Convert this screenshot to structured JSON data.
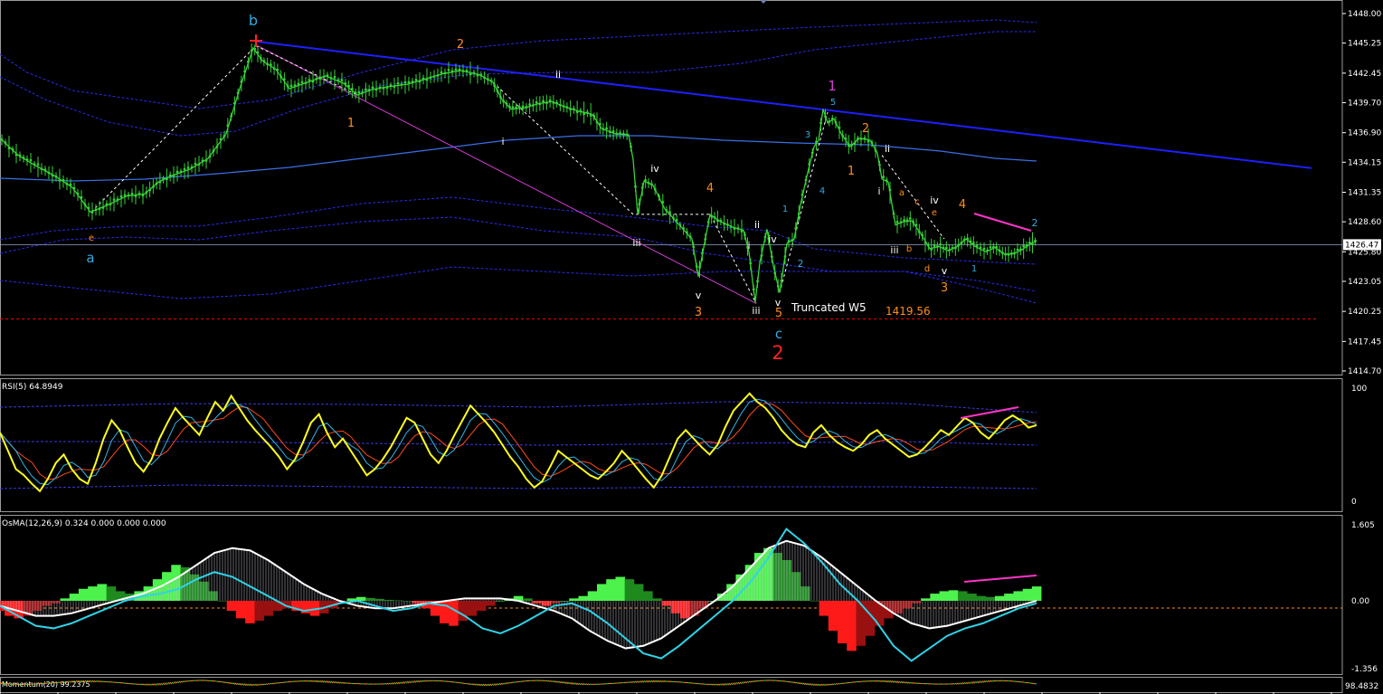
{
  "chart_data": {
    "type": "line",
    "main": {
      "y_ticks": [
        "1448.00",
        "1445.25",
        "1442.45",
        "1439.70",
        "1436.90",
        "1434.15",
        "1431.35",
        "1428.60",
        "1425.80",
        "1423.05",
        "1420.25",
        "1417.45",
        "1414.70"
      ],
      "ylim": [
        1414.7,
        1448.0
      ],
      "current_price": "1426.47",
      "reference_level": 1419.56,
      "reference_level_label": "1419.56",
      "annotation": "Truncated W5",
      "colors": {
        "bull": "#37d337",
        "bear": "#37d337",
        "trendline": "#1f1fff",
        "envelope": "#2a2ae8",
        "ma": "#3b6fe6",
        "support": "#ff0000",
        "divergence": "#ff35c9",
        "wave_orange": "#ff8c1a",
        "wave_cyan": "#36a9e1",
        "wave_purple": "#d43bd4",
        "wave_red": "#ff2222"
      },
      "price_path": [
        [
          0,
          1436.4
        ],
        [
          20,
          1434.8
        ],
        [
          40,
          1433.8
        ],
        [
          60,
          1432.9
        ],
        [
          80,
          1431.8
        ],
        [
          100,
          1429.5
        ],
        [
          120,
          1430.2
        ],
        [
          140,
          1431.0
        ],
        [
          160,
          1431.2
        ],
        [
          175,
          1432.3
        ],
        [
          190,
          1432.9
        ],
        [
          210,
          1433.5
        ],
        [
          230,
          1434.5
        ],
        [
          250,
          1436.8
        ],
        [
          265,
          1441.0
        ],
        [
          280,
          1444.8
        ],
        [
          290,
          1443.6
        ],
        [
          305,
          1442.8
        ],
        [
          320,
          1441.0
        ],
        [
          340,
          1441.6
        ],
        [
          360,
          1442.2
        ],
        [
          380,
          1441.5
        ],
        [
          395,
          1440.4
        ],
        [
          410,
          1440.9
        ],
        [
          430,
          1441.2
        ],
        [
          450,
          1441.4
        ],
        [
          470,
          1441.9
        ],
        [
          490,
          1442.4
        ],
        [
          510,
          1442.7
        ],
        [
          530,
          1442.3
        ],
        [
          545,
          1441.6
        ],
        [
          555,
          1440.0
        ],
        [
          565,
          1439.1
        ],
        [
          580,
          1439.2
        ],
        [
          595,
          1439.6
        ],
        [
          610,
          1439.8
        ],
        [
          625,
          1439.3
        ],
        [
          640,
          1438.9
        ],
        [
          655,
          1438.6
        ],
        [
          665,
          1437.3
        ],
        [
          680,
          1436.8
        ],
        [
          695,
          1436.7
        ],
        [
          700,
          1434.4
        ],
        [
          705,
          1429.3
        ],
        [
          712,
          1432.4
        ],
        [
          722,
          1432.0
        ],
        [
          735,
          1429.8
        ],
        [
          750,
          1428.4
        ],
        [
          765,
          1427.0
        ],
        [
          772,
          1423.5
        ],
        [
          778,
          1426.2
        ],
        [
          785,
          1429.3
        ],
        [
          795,
          1428.7
        ],
        [
          810,
          1428.1
        ],
        [
          822,
          1427.8
        ],
        [
          828,
          1425.8
        ],
        [
          835,
          1421.1
        ],
        [
          840,
          1424.8
        ],
        [
          848,
          1427.9
        ],
        [
          855,
          1424.5
        ],
        [
          862,
          1422.0
        ],
        [
          870,
          1426.6
        ],
        [
          878,
          1427.0
        ],
        [
          885,
          1430.2
        ],
        [
          893,
          1433.2
        ],
        [
          900,
          1435.6
        ],
        [
          905,
          1436.2
        ],
        [
          910,
          1439.1
        ],
        [
          915,
          1437.8
        ],
        [
          922,
          1438.2
        ],
        [
          930,
          1436.8
        ],
        [
          940,
          1435.6
        ],
        [
          950,
          1436.4
        ],
        [
          962,
          1436.2
        ],
        [
          970,
          1435.0
        ],
        [
          975,
          1432.6
        ],
        [
          982,
          1432.3
        ],
        [
          990,
          1428.3
        ],
        [
          998,
          1428.6
        ],
        [
          1008,
          1428.7
        ],
        [
          1018,
          1427.5
        ],
        [
          1028,
          1426.1
        ],
        [
          1038,
          1426.3
        ],
        [
          1048,
          1425.9
        ],
        [
          1058,
          1426.3
        ],
        [
          1068,
          1427.0
        ],
        [
          1078,
          1426.3
        ],
        [
          1090,
          1425.8
        ],
        [
          1100,
          1426.2
        ],
        [
          1110,
          1425.6
        ],
        [
          1120,
          1425.6
        ],
        [
          1130,
          1426.0
        ],
        [
          1140,
          1426.6
        ],
        [
          1146,
          1426.8
        ]
      ],
      "wave_labels": [
        {
          "text": "b",
          "x": 280,
          "y": 28,
          "color": "#36a9e1",
          "size": 16
        },
        {
          "text": "a",
          "x": 100,
          "y": 290,
          "color": "#36a9e1",
          "size": 15
        },
        {
          "text": "e",
          "x": 101,
          "y": 266,
          "color": "#ff8c1a",
          "size": 10
        },
        {
          "text": "2",
          "x": 509,
          "y": 53,
          "color": "#ff8c1a",
          "size": 13
        },
        {
          "text": "1",
          "x": 388,
          "y": 140,
          "color": "#ff8c1a",
          "size": 13
        },
        {
          "text": "ii",
          "x": 617,
          "y": 86,
          "color": "#ffffff",
          "size": 11
        },
        {
          "text": "i",
          "x": 556,
          "y": 160,
          "color": "#ffffff",
          "size": 11
        },
        {
          "text": "iv",
          "x": 724,
          "y": 190,
          "color": "#ffffff",
          "size": 11
        },
        {
          "text": "iii",
          "x": 704,
          "y": 272,
          "color": "#ffffff",
          "size": 11
        },
        {
          "text": "4",
          "x": 785,
          "y": 212,
          "color": "#ff8c1a",
          "size": 13
        },
        {
          "text": "v",
          "x": 772,
          "y": 330,
          "color": "#ffffff",
          "size": 11
        },
        {
          "text": "3",
          "x": 772,
          "y": 349,
          "color": "#ff8c1a",
          "size": 13
        },
        {
          "text": "ii",
          "x": 837,
          "y": 252,
          "color": "#ffffff",
          "size": 11
        },
        {
          "text": "i",
          "x": 828,
          "y": 275,
          "color": "#ffffff",
          "size": 11
        },
        {
          "text": "iv",
          "x": 854,
          "y": 268,
          "color": "#ffffff",
          "size": 11
        },
        {
          "text": "iii",
          "x": 836,
          "y": 347,
          "color": "#ffffff",
          "size": 11
        },
        {
          "text": "v",
          "x": 860,
          "y": 338,
          "color": "#ffffff",
          "size": 11
        },
        {
          "text": "5",
          "x": 861,
          "y": 350,
          "color": "#ff8c1a",
          "size": 13
        },
        {
          "text": "c",
          "x": 861,
          "y": 374,
          "color": "#36a9e1",
          "size": 15
        },
        {
          "text": "2",
          "x": 860,
          "y": 397,
          "color": "#ff2222",
          "size": 21
        },
        {
          "text": "1",
          "x": 920,
          "y": 100,
          "color": "#d43bd4",
          "size": 15
        },
        {
          "text": "5",
          "x": 921,
          "y": 116,
          "color": "#36a9e1",
          "size": 10
        },
        {
          "text": "3",
          "x": 893,
          "y": 152,
          "color": "#36a9e1",
          "size": 10
        },
        {
          "text": "4",
          "x": 909,
          "y": 214,
          "color": "#36a9e1",
          "size": 10
        },
        {
          "text": "1",
          "x": 868,
          "y": 234,
          "color": "#36a9e1",
          "size": 10
        },
        {
          "text": "2",
          "x": 885,
          "y": 295,
          "color": "#36a9e1",
          "size": 11
        },
        {
          "text": "2",
          "x": 957,
          "y": 146,
          "color": "#ff8c1a",
          "size": 13
        },
        {
          "text": "1",
          "x": 941,
          "y": 193,
          "color": "#ff8c1a",
          "size": 13
        },
        {
          "text": "ii",
          "x": 981,
          "y": 168,
          "color": "#ffffff",
          "size": 11
        },
        {
          "text": "i",
          "x": 972,
          "y": 215,
          "color": "#ffffff",
          "size": 11
        },
        {
          "text": "iii",
          "x": 989,
          "y": 280,
          "color": "#ffffff",
          "size": 11
        },
        {
          "text": "a",
          "x": 997,
          "y": 216,
          "color": "#ff8c1a",
          "size": 10
        },
        {
          "text": "c",
          "x": 1014,
          "y": 226,
          "color": "#ff8c1a",
          "size": 10
        },
        {
          "text": "e",
          "x": 1033,
          "y": 238,
          "color": "#ff8c1a",
          "size": 10
        },
        {
          "text": "iv",
          "x": 1033,
          "y": 225,
          "color": "#ffffff",
          "size": 11
        },
        {
          "text": "b",
          "x": 1005,
          "y": 278,
          "color": "#ff8c1a",
          "size": 10
        },
        {
          "text": "d",
          "x": 1025,
          "y": 300,
          "color": "#ff8c1a",
          "size": 10
        },
        {
          "text": "v",
          "x": 1044,
          "y": 303,
          "color": "#ffffff",
          "size": 11
        },
        {
          "text": "3",
          "x": 1044,
          "y": 322,
          "color": "#ff8c1a",
          "size": 13
        },
        {
          "text": "4",
          "x": 1064,
          "y": 230,
          "color": "#ff8c1a",
          "size": 13
        },
        {
          "text": "1",
          "x": 1077,
          "y": 300,
          "color": "#36a9e1",
          "size": 10
        },
        {
          "text": "2",
          "x": 1144,
          "y": 250,
          "color": "#36a9e1",
          "size": 11
        }
      ]
    },
    "rsi": {
      "label": "RSI(5) 64.8949",
      "y_ticks": [
        "100",
        "0"
      ],
      "ylim": [
        0,
        100
      ],
      "values": [
        60,
        45,
        30,
        25,
        18,
        12,
        22,
        35,
        42,
        30,
        22,
        18,
        35,
        55,
        70,
        62,
        48,
        35,
        28,
        38,
        55,
        68,
        80,
        72,
        65,
        58,
        72,
        85,
        78,
        90,
        80,
        70,
        62,
        55,
        48,
        40,
        30,
        38,
        52,
        68,
        75,
        60,
        48,
        55,
        45,
        35,
        25,
        30,
        38,
        48,
        60,
        72,
        68,
        55,
        42,
        35,
        45,
        58,
        70,
        82,
        75,
        68,
        60,
        50,
        40,
        32,
        22,
        15,
        20,
        32,
        45,
        40,
        35,
        30,
        25,
        22,
        28,
        35,
        45,
        38,
        30,
        22,
        15,
        25,
        40,
        55,
        62,
        55,
        48,
        42,
        50,
        65,
        78,
        85,
        92,
        85,
        80,
        72,
        62,
        55,
        50,
        48,
        60,
        66,
        58,
        52,
        48,
        45,
        50,
        58,
        62,
        55,
        50,
        45,
        40,
        42,
        48,
        55,
        62,
        58,
        65,
        72,
        68,
        60,
        55,
        62,
        70,
        74,
        70,
        64,
        66
      ],
      "levels": [
        20,
        50,
        80
      ]
    },
    "osma": {
      "label": "OsMA(12,26,9) 0.324 0.000 0.000 0.000",
      "y_ticks": [
        "1.605",
        "0.00",
        "-1.356"
      ],
      "ylim": [
        -1.356,
        1.605
      ],
      "hist": [
        -0.2,
        -0.3,
        -0.35,
        -0.3,
        -0.2,
        -0.1,
        -0.05,
        0.05,
        0.15,
        0.25,
        0.3,
        0.35,
        0.3,
        0.2,
        0.15,
        0.2,
        0.3,
        0.45,
        0.6,
        0.75,
        0.7,
        0.55,
        0.4,
        0.2,
        0.0,
        -0.2,
        -0.35,
        -0.45,
        -0.4,
        -0.3,
        -0.2,
        -0.15,
        -0.2,
        -0.25,
        -0.3,
        -0.25,
        -0.15,
        -0.05,
        0.05,
        0.08,
        0.06,
        0.04,
        0.02,
        0.01,
        0.0,
        -0.05,
        -0.15,
        -0.3,
        -0.45,
        -0.5,
        -0.4,
        -0.3,
        -0.2,
        -0.1,
        0.0,
        0.05,
        0.1,
        0.05,
        -0.05,
        -0.1,
        -0.05,
        0.0,
        0.05,
        0.1,
        0.2,
        0.35,
        0.45,
        0.5,
        0.45,
        0.35,
        0.2,
        0.05,
        -0.1,
        -0.25,
        -0.35,
        -0.3,
        -0.15,
        0.0,
        0.15,
        0.35,
        0.55,
        0.75,
        1.0,
        1.1,
        1.0,
        0.85,
        0.6,
        0.3,
        0.0,
        -0.3,
        -0.6,
        -0.85,
        -1.0,
        -0.9,
        -0.7,
        -0.5,
        -0.35,
        -0.25,
        -0.15,
        -0.05,
        0.05,
        0.15,
        0.2,
        0.22,
        0.2,
        0.15,
        0.1,
        0.08,
        0.1,
        0.15,
        0.2,
        0.25,
        0.3
      ],
      "signal": [
        -0.1,
        -0.2,
        -0.3,
        -0.3,
        -0.25,
        -0.15,
        -0.05,
        0.05,
        0.15,
        0.3,
        0.5,
        0.75,
        1.0,
        1.1,
        1.05,
        0.85,
        0.6,
        0.35,
        0.15,
        0.0,
        -0.1,
        -0.15,
        -0.15,
        -0.1,
        -0.05,
        0.0,
        0.05,
        0.05,
        0.05,
        0.0,
        -0.1,
        -0.2,
        -0.35,
        -0.6,
        -0.8,
        -0.95,
        -0.9,
        -0.75,
        -0.5,
        -0.25,
        0.0,
        0.3,
        0.7,
        1.1,
        1.25,
        1.15,
        0.9,
        0.6,
        0.3,
        0.0,
        -0.25,
        -0.45,
        -0.55,
        -0.5,
        -0.4,
        -0.3,
        -0.2,
        -0.1,
        0.0
      ],
      "macd": [
        -0.1,
        -0.3,
        -0.5,
        -0.55,
        -0.45,
        -0.3,
        -0.15,
        0.0,
        0.1,
        0.15,
        0.25,
        0.45,
        0.6,
        0.5,
        0.3,
        0.1,
        -0.1,
        -0.2,
        -0.15,
        -0.05,
        0.0,
        -0.1,
        -0.2,
        -0.15,
        -0.05,
        -0.1,
        -0.3,
        -0.55,
        -0.65,
        -0.5,
        -0.3,
        -0.1,
        -0.05,
        -0.2,
        -0.45,
        -0.75,
        -1.05,
        -1.15,
        -0.9,
        -0.6,
        -0.3,
        0.0,
        0.4,
        0.9,
        1.5,
        1.2,
        0.8,
        0.35,
        0.0,
        -0.4,
        -0.9,
        -1.2,
        -0.95,
        -0.7,
        -0.55,
        -0.45,
        -0.3,
        -0.15,
        -0.05
      ]
    },
    "bottom_panel": {
      "label": "Momentum(20) 99.2375",
      "right_value": "98.4832"
    }
  }
}
